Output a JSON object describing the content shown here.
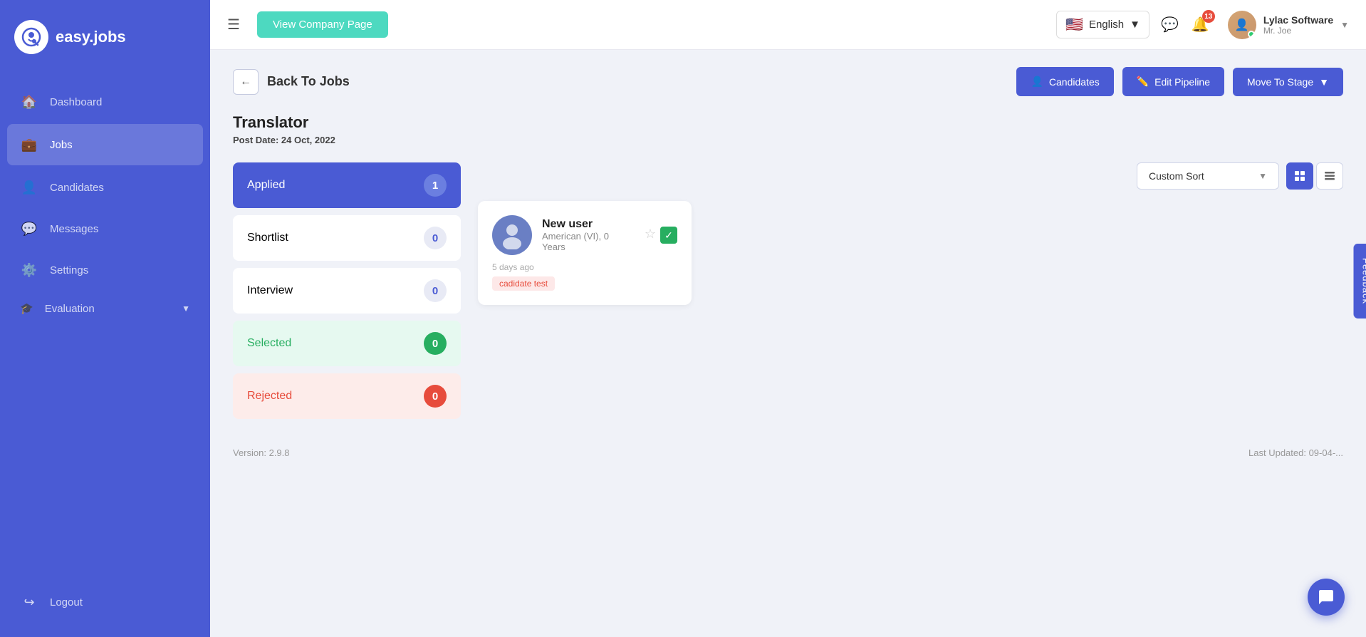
{
  "app": {
    "name": "easy.jobs",
    "logo_icon": "🔍"
  },
  "sidebar": {
    "items": [
      {
        "id": "dashboard",
        "label": "Dashboard",
        "icon": "🏠",
        "active": false
      },
      {
        "id": "jobs",
        "label": "Jobs",
        "icon": "💼",
        "active": true
      },
      {
        "id": "candidates",
        "label": "Candidates",
        "icon": "👤",
        "active": false
      },
      {
        "id": "messages",
        "label": "Messages",
        "icon": "💬",
        "active": false
      },
      {
        "id": "settings",
        "label": "Settings",
        "icon": "⚙️",
        "active": false
      },
      {
        "id": "evaluation",
        "label": "Evaluation",
        "icon": "🎓",
        "active": false
      }
    ],
    "logout_label": "Logout"
  },
  "topbar": {
    "menu_icon": "☰",
    "view_company_btn": "View Company Page",
    "language": "English",
    "notification_count": "13",
    "user": {
      "company": "Lylac Software",
      "name": "Mr. Joe"
    }
  },
  "header": {
    "back_label": "Back To Jobs",
    "candidates_btn": "Candidates",
    "edit_pipeline_btn": "Edit Pipeline",
    "move_to_stage_btn": "Move To Stage"
  },
  "job": {
    "title": "Translator",
    "post_date_label": "Post Date:",
    "post_date": "24 Oct, 2022"
  },
  "sort": {
    "label": "Custom Sort",
    "chevron": "▼"
  },
  "stages": [
    {
      "id": "applied",
      "name": "Applied",
      "count": "1",
      "type": "active"
    },
    {
      "id": "shortlist",
      "name": "Shortlist",
      "count": "0",
      "type": "normal"
    },
    {
      "id": "interview",
      "name": "Interview",
      "count": "0",
      "type": "normal"
    },
    {
      "id": "selected",
      "name": "Selected",
      "count": "0",
      "type": "selected"
    },
    {
      "id": "rejected",
      "name": "Rejected",
      "count": "0",
      "type": "rejected"
    }
  ],
  "candidate": {
    "name": "New user",
    "location": "American (VI),",
    "experience": "0 Years",
    "time_ago": "5 days ago",
    "tag": "cadidate test"
  },
  "footer": {
    "version": "Version: 2.9.8",
    "last_updated": "Last Updated: 09-04-..."
  },
  "feedback": "Feedback"
}
